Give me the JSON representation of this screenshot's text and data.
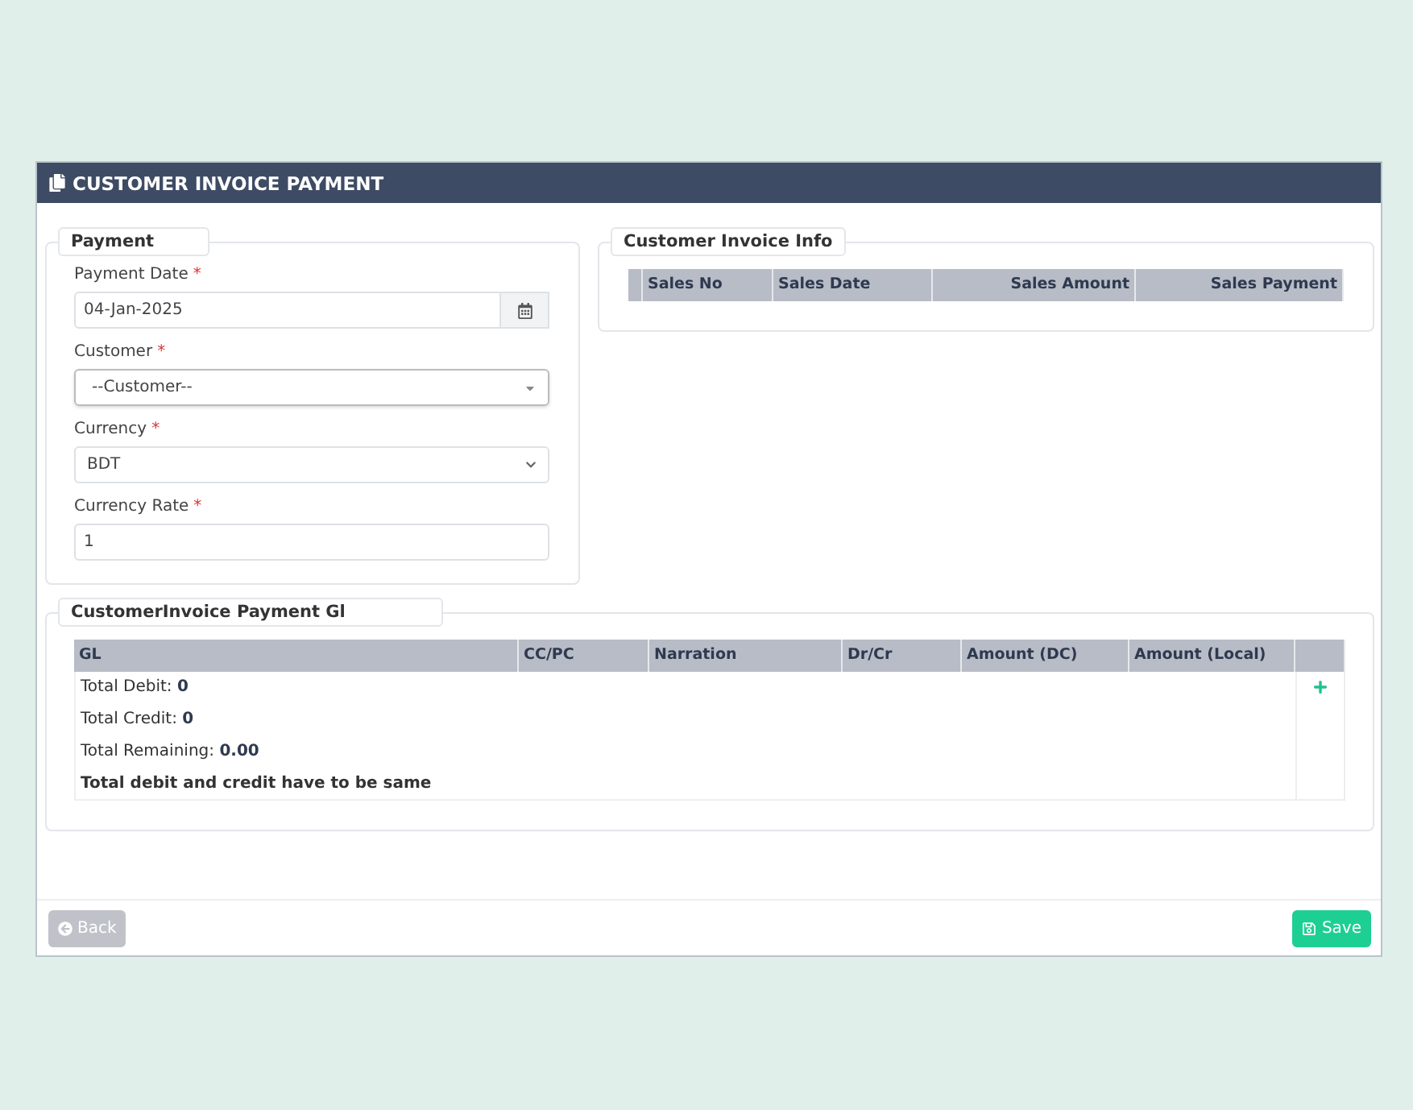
{
  "window": {
    "title": "CUSTOMER INVOICE PAYMENT"
  },
  "payment": {
    "legend": "Payment",
    "fields": [
      {
        "kind": "date",
        "label": "Payment Date",
        "required_mark": "*",
        "value": "04-Jan-2025"
      },
      {
        "kind": "combo",
        "label": "Customer",
        "required_mark": "*",
        "value": "--Customer--"
      },
      {
        "kind": "select",
        "label": "Currency",
        "required_mark": "*",
        "value": "BDT"
      },
      {
        "kind": "text",
        "label": "Currency Rate",
        "required_mark": "*",
        "value": "1"
      }
    ]
  },
  "invoice_info": {
    "legend": "Customer Invoice Info",
    "columns": [
      "Sales No",
      "Sales Date",
      "Sales Amount",
      "Sales Payment"
    ]
  },
  "gl": {
    "legend": "CustomerInvoice Payment Gl",
    "columns": [
      "GL",
      "CC/PC",
      "Narration",
      "Dr/Cr",
      "Amount (DC)",
      "Amount (Local)"
    ],
    "totals": [
      {
        "kind": "total",
        "text": "Total Debit: **0**"
      },
      {
        "kind": "total",
        "text": "Total Credit: **0**"
      },
      {
        "kind": "total",
        "text": "Total Remaining: **0.00**"
      },
      {
        "kind": "note",
        "text": "Total debit and credit have to be same"
      }
    ]
  },
  "footer": {
    "back": {
      "label": "Back",
      "disabled": true
    },
    "save": {
      "label": "Save",
      "disabled": false
    }
  }
}
